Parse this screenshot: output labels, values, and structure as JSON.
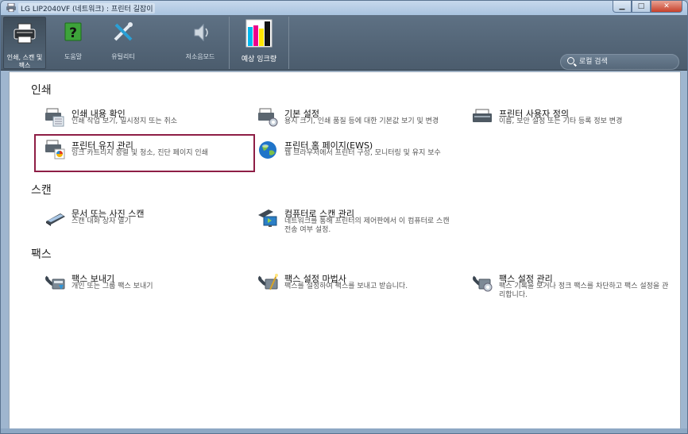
{
  "window": {
    "title": "LG LIP2040VF (네트워크) : 프린터 길잡이"
  },
  "toolbar": {
    "items": [
      {
        "label": "인쇄, 스캔 및\n팩스",
        "icon": "printer-icon",
        "active": true
      },
      {
        "label": "도움말",
        "icon": "help-icon"
      },
      {
        "label": "유틸리티",
        "icon": "tools-icon"
      },
      {
        "label": "저소음모드",
        "icon": "speaker-icon"
      },
      {
        "label": "예상 잉크량",
        "icon": "ink-levels-icon"
      }
    ]
  },
  "search": {
    "placeholder": "로컬 검색"
  },
  "sections": {
    "print": {
      "title": "인쇄",
      "entries": [
        {
          "title": "인쇄 내용 확인",
          "desc": "인쇄 작업 보기, 일시정지 또는 취소",
          "icon": "print-queue-icon"
        },
        {
          "title": "기본 설정",
          "desc": "용지 크기, 인쇄 품질 등에 대한 기본값 보기 및 변경",
          "icon": "preferences-icon"
        },
        {
          "title": "프린터 사용자 정의",
          "desc": "이름, 보안 설정 또는 기타 등록 정보 변경",
          "icon": "customize-printer-icon"
        },
        {
          "title": "프린터 유지 관리",
          "desc": "잉크 카트리지 정렬 및 청소, 진단 페이지 인쇄",
          "icon": "maintenance-icon"
        },
        {
          "title": "프린터 홈 페이지(EWS)",
          "desc": "웹 브라우저에서 프린터 구성, 모니터링 및 유지 보수",
          "icon": "globe-icon"
        }
      ]
    },
    "scan": {
      "title": "스캔",
      "entries": [
        {
          "title": "문서 또는 사진 스캔",
          "desc": "스캔 대화 상자 열기",
          "icon": "scanner-icon"
        },
        {
          "title": "컴퓨터로 스캔 관리",
          "desc": "네트워크를 통해 프린터의 제어판에서 이 컴퓨터로 스캔 전송 여부 설정.",
          "icon": "scan-to-computer-icon"
        }
      ]
    },
    "fax": {
      "title": "팩스",
      "entries": [
        {
          "title": "팩스 보내기",
          "desc": "개인 또는 그룹 팩스 보내기",
          "icon": "fax-send-icon"
        },
        {
          "title": "팩스 설정 마법사",
          "desc": "팩스를 설정하여 팩스를 보내고 받습니다.",
          "icon": "fax-wizard-icon"
        },
        {
          "title": "팩스 설정 관리",
          "desc": "팩스 기록을 보거나 정크 팩스를 차단하고 팩스 설정을 관리합니다.",
          "icon": "fax-settings-icon"
        }
      ]
    }
  }
}
